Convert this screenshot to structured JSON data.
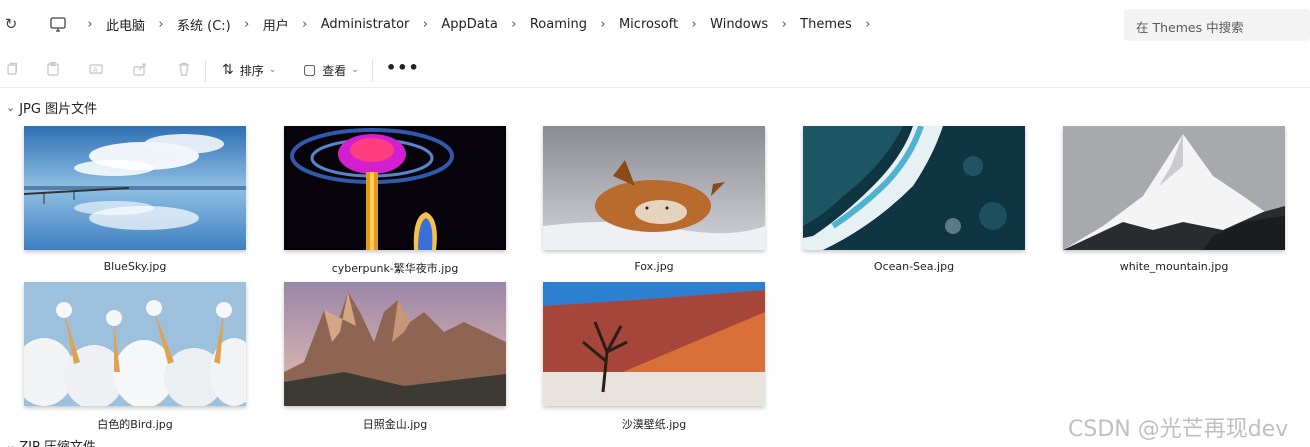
{
  "address_bar": {
    "breadcrumbs": [
      "此电脑",
      "系统 (C:)",
      "用户",
      "Administrator",
      "AppData",
      "Roaming",
      "Microsoft",
      "Windows",
      "Themes"
    ],
    "search_placeholder": "在 Themes 中搜索"
  },
  "toolbar": {
    "sort_label": "排序",
    "view_label": "查看",
    "more_label": "•••"
  },
  "groups": [
    {
      "header": "JPG 图片文件",
      "files": [
        {
          "name": "BlueSky.jpg"
        },
        {
          "name": "cyberpunk-繁华夜市.jpg"
        },
        {
          "name": "Fox.jpg"
        },
        {
          "name": "Ocean-Sea.jpg"
        },
        {
          "name": "white_mountain.jpg"
        },
        {
          "name": "白色的Bird.jpg"
        },
        {
          "name": "日照金山.jpg"
        },
        {
          "name": "沙漠壁纸.jpg"
        }
      ]
    },
    {
      "header": "ZIP 压缩文件"
    }
  ],
  "watermark": "CSDN @光芒再现dev",
  "colors": {
    "accent": "#0067c0",
    "divider": "#e1e1e1"
  }
}
